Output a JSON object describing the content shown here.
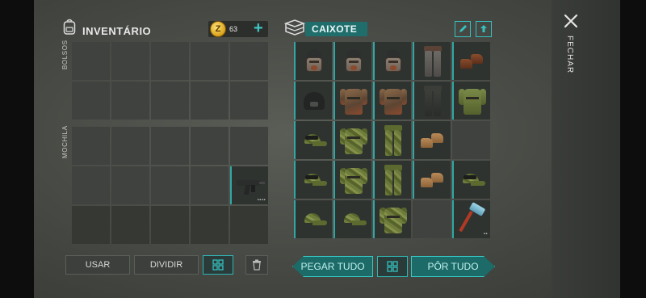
{
  "inventory": {
    "title": "INVENTÁRIO",
    "coins": "63",
    "coin_symbol": "Z",
    "add_symbol": "+",
    "pockets_label": "BOLSOS",
    "backpack_label": "MOCHILA"
  },
  "crate": {
    "title": "CAIXOTE"
  },
  "buttons": {
    "use": "USAR",
    "split": "DIVIDIR",
    "take_all": "PEGAR TUDO",
    "put_all": "PÔR TUDO"
  },
  "side": {
    "close_label": "FECHAR"
  },
  "item_icons": [
    "gas-mask-helmet-icon",
    "combat-helmet-icon",
    "metal-pants-icon",
    "brown-boots-icon",
    "rusty-armor-icon",
    "camo-armor-icon",
    "camo-pants-icon",
    "tan-boots-icon",
    "camo-cap-icon",
    "dark-pants-icon",
    "olive-vest-icon",
    "smg-icon",
    "hammer-icon"
  ],
  "colors": {
    "accent": "#2fb5b3",
    "accent_dark": "#1d6b68",
    "coin": "#e0b02a",
    "panel": "#3f423e"
  }
}
